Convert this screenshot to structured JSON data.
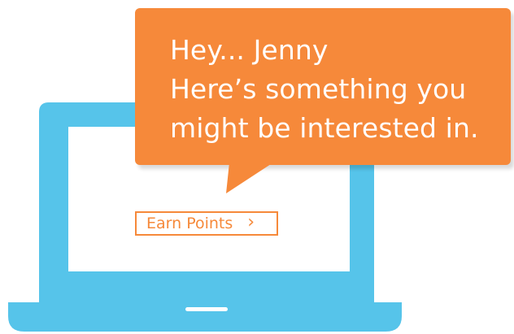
{
  "bubble": {
    "line1": "Hey... Jenny",
    "line2": "Here’s something you",
    "line3": "might be interested in."
  },
  "cta": {
    "label": "Earn Points",
    "chevron": "›"
  },
  "colors": {
    "laptop": "#56c4ea",
    "accent": "#f6893a",
    "background": "#ffffff"
  },
  "icons": {
    "laptop": "laptop-icon",
    "chevron": "chevron-right-icon"
  }
}
